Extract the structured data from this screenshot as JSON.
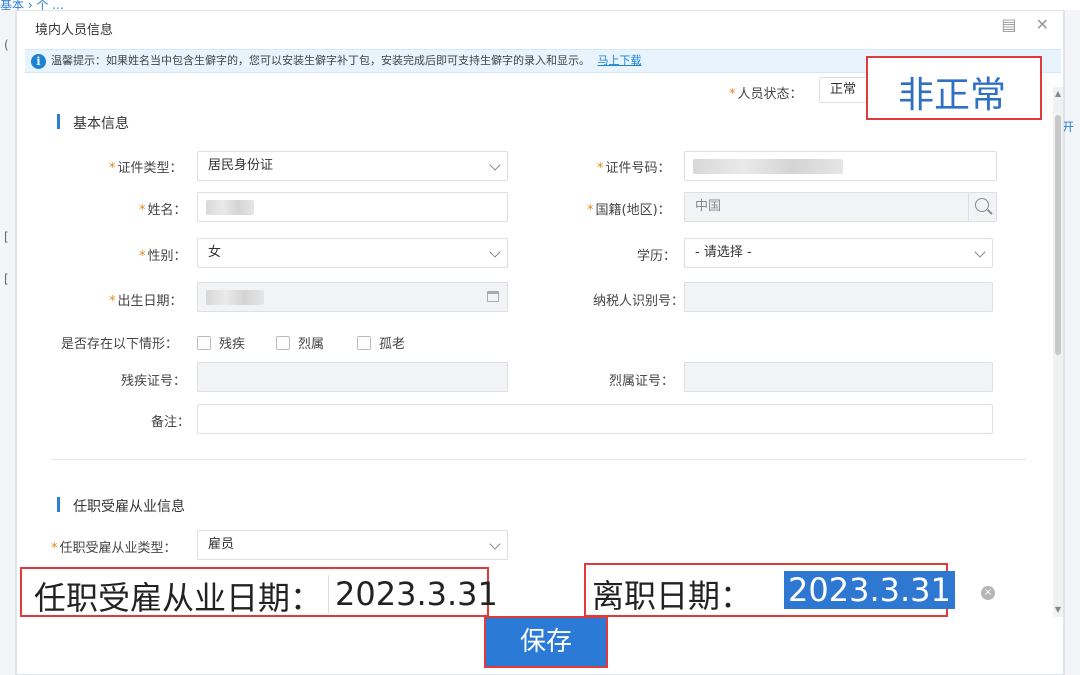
{
  "background": {
    "breadcrumb": "基本 › 个 ...",
    "right_button": "开"
  },
  "dialog": {
    "title": "境内人员信息",
    "icons": [
      "restore-icon",
      "close-icon"
    ]
  },
  "notice": {
    "text": "温馨提示：如果姓名当中包含生僻字的，您可以安装生僻字补丁包，安装完成后即可支持生僻字的录入和显示。",
    "link": "马上下载"
  },
  "status": {
    "label": "人员状态：",
    "value": "正常",
    "callout": "非正常"
  },
  "basic": {
    "title": "基本信息",
    "id_type_label": "证件类型：",
    "id_type_value": "居民身份证",
    "id_no_label": "证件号码：",
    "name_label": "姓名：",
    "nationality_label": "国籍(地区)：",
    "nationality_value": "中国",
    "gender_label": "性别：",
    "gender_value": "女",
    "education_label": "学历：",
    "education_value": "- 请选择 -",
    "birth_label": "出生日期：",
    "taxid_label": "纳税人识别号：",
    "situation_label": "是否存在以下情形：",
    "situation_options": [
      "残疾",
      "烈属",
      "孤老"
    ],
    "disability_label": "残疾证号：",
    "martyr_label": "烈属证号：",
    "remark_label": "备注："
  },
  "employment": {
    "title": "任职受雇从业信息",
    "type_label": "任职受雇从业类型：",
    "type_value": "雇员",
    "date_label": "任职受雇从业日期：",
    "date_value": "2023.3.31",
    "leave_label": "离职日期：",
    "leave_value": "2023.3.31"
  },
  "save_button": "保存",
  "colors": {
    "accent": "#2a7ad6",
    "callout": "#e03a3a",
    "required": "#e0891b"
  }
}
